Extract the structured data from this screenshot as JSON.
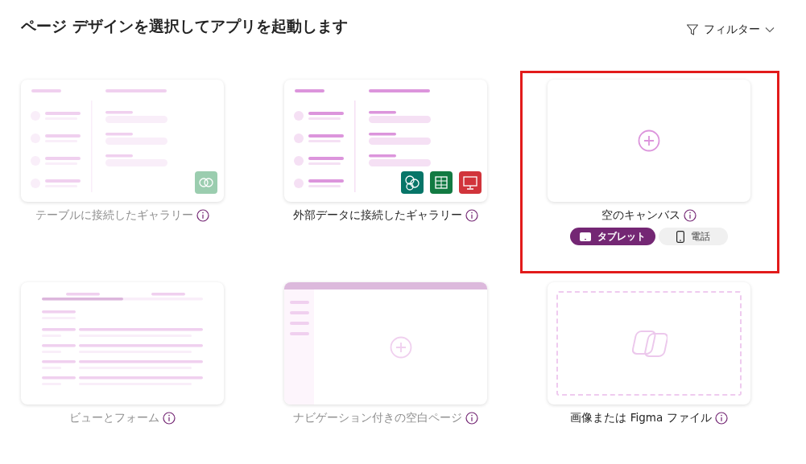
{
  "title": "ページ デザインを選択してアプリを起動します",
  "filter": {
    "label": "フィルター"
  },
  "templates": [
    {
      "kind": "table-gallery",
      "label": "テーブルに接続したギャラリー",
      "disabled": true,
      "selected": false
    },
    {
      "kind": "data-gallery",
      "label": "外部データに接続したギャラリー",
      "disabled": false,
      "selected": false
    },
    {
      "kind": "blank-canvas",
      "label": "空のキャンバス",
      "disabled": false,
      "selected": true,
      "form_factors": [
        {
          "kind": "tablet",
          "label": "タブレット",
          "selected": true
        },
        {
          "kind": "phone",
          "label": "電話",
          "selected": false
        }
      ]
    },
    {
      "kind": "view-form",
      "label": "ビューとフォーム",
      "disabled": true,
      "selected": false
    },
    {
      "kind": "nav-blank",
      "label": "ナビゲーション付きの空白ページ",
      "disabled": true,
      "selected": false
    },
    {
      "kind": "image-figma",
      "label": "画像または Figma ファイル",
      "disabled": false,
      "selected": false
    }
  ]
}
